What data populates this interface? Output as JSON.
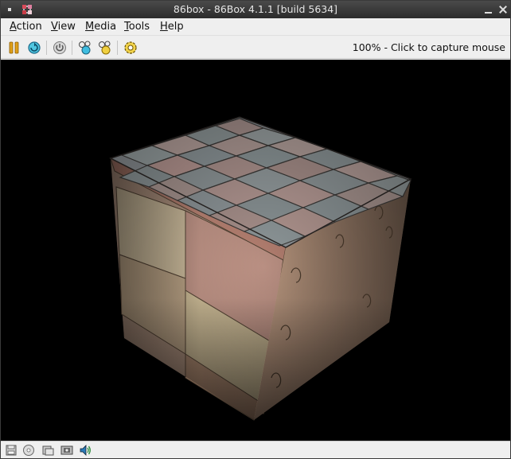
{
  "window": {
    "title": "86box - 86Box 4.1.1 [build 5634]"
  },
  "menubar": {
    "items": [
      {
        "first": "A",
        "rest": "ction"
      },
      {
        "first": "V",
        "rest": "iew"
      },
      {
        "first": "M",
        "rest": "edia"
      },
      {
        "first": "T",
        "rest": "ools"
      },
      {
        "first": "H",
        "rest": "elp"
      }
    ]
  },
  "toolbar": {
    "buttons": [
      "pause-icon",
      "reset-icon",
      "power-icon",
      "ctrl-alt-del-icon",
      "ctrl-alt-esc-icon",
      "settings-icon"
    ],
    "status": "100% - Click to capture mouse"
  },
  "statusbar": {
    "icons": [
      "floppy-drive-icon",
      "cdrom-drive-icon",
      "hard-disk-icon",
      "network-icon",
      "sound-icon"
    ]
  },
  "colors": {
    "titlebar": "#2f2f2f",
    "chrome": "#efefef",
    "display_bg": "#000000"
  }
}
